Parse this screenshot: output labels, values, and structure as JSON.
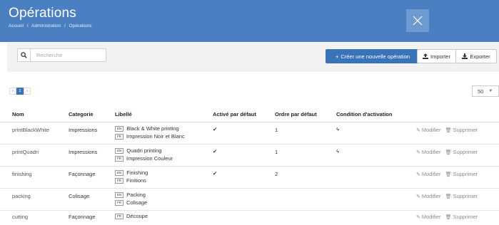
{
  "header": {
    "title": "Opérations",
    "breadcrumb": [
      "Accueil",
      "/",
      "Administration",
      "/",
      "Opérations"
    ]
  },
  "toolbar": {
    "search_placeholder": "Recherche",
    "create_label": "Créer une nouvelle opération",
    "import_label": "Importer",
    "export_label": "Exporter"
  },
  "pagination": {
    "prev": "«",
    "current": "1",
    "next": "»",
    "page_size": "50"
  },
  "table": {
    "columns": [
      "Nom",
      "Categorie",
      "Libellé",
      "Activé par défaut",
      "Ordre par défaut",
      "Condition d'activation"
    ],
    "lang_en": "EN",
    "lang_fr": "FR",
    "edit_label": "Modifier",
    "delete_label": "Supprimer",
    "rows": [
      {
        "name": "printBlackWhite",
        "category": "Impressions",
        "en": "Black & White printing",
        "fr": "Impression Noir et Blanc",
        "active": "✔",
        "order": "1",
        "condition": "ϟ"
      },
      {
        "name": "printQuadri",
        "category": "Impressions",
        "en": "Quadri printing",
        "fr": "Impression Couleur",
        "active": "✔",
        "order": "1",
        "condition": "ϟ"
      },
      {
        "name": "finishing",
        "category": "Façonnage",
        "en": "Finishing",
        "fr": "Finitions",
        "active": "✔",
        "order": "2",
        "condition": ""
      },
      {
        "name": "packing",
        "category": "Colisage",
        "en": "Packing",
        "fr": "Colisage",
        "active": "",
        "order": "",
        "condition": ""
      },
      {
        "name": "cutting",
        "category": "Façonnage",
        "en": "",
        "fr": "Découpe",
        "active": "",
        "order": "",
        "condition": ""
      }
    ]
  },
  "icons": {
    "close": "close-icon",
    "search": "search-icon",
    "plus": "plus-icon",
    "upload": "upload-icon",
    "download": "download-icon",
    "pencil": "pencil-icon",
    "trash": "trash-icon"
  },
  "colors": {
    "header_bg": "#4a7fc1",
    "primary": "#3973b8",
    "toolbar_bg": "#f2f2f2"
  }
}
